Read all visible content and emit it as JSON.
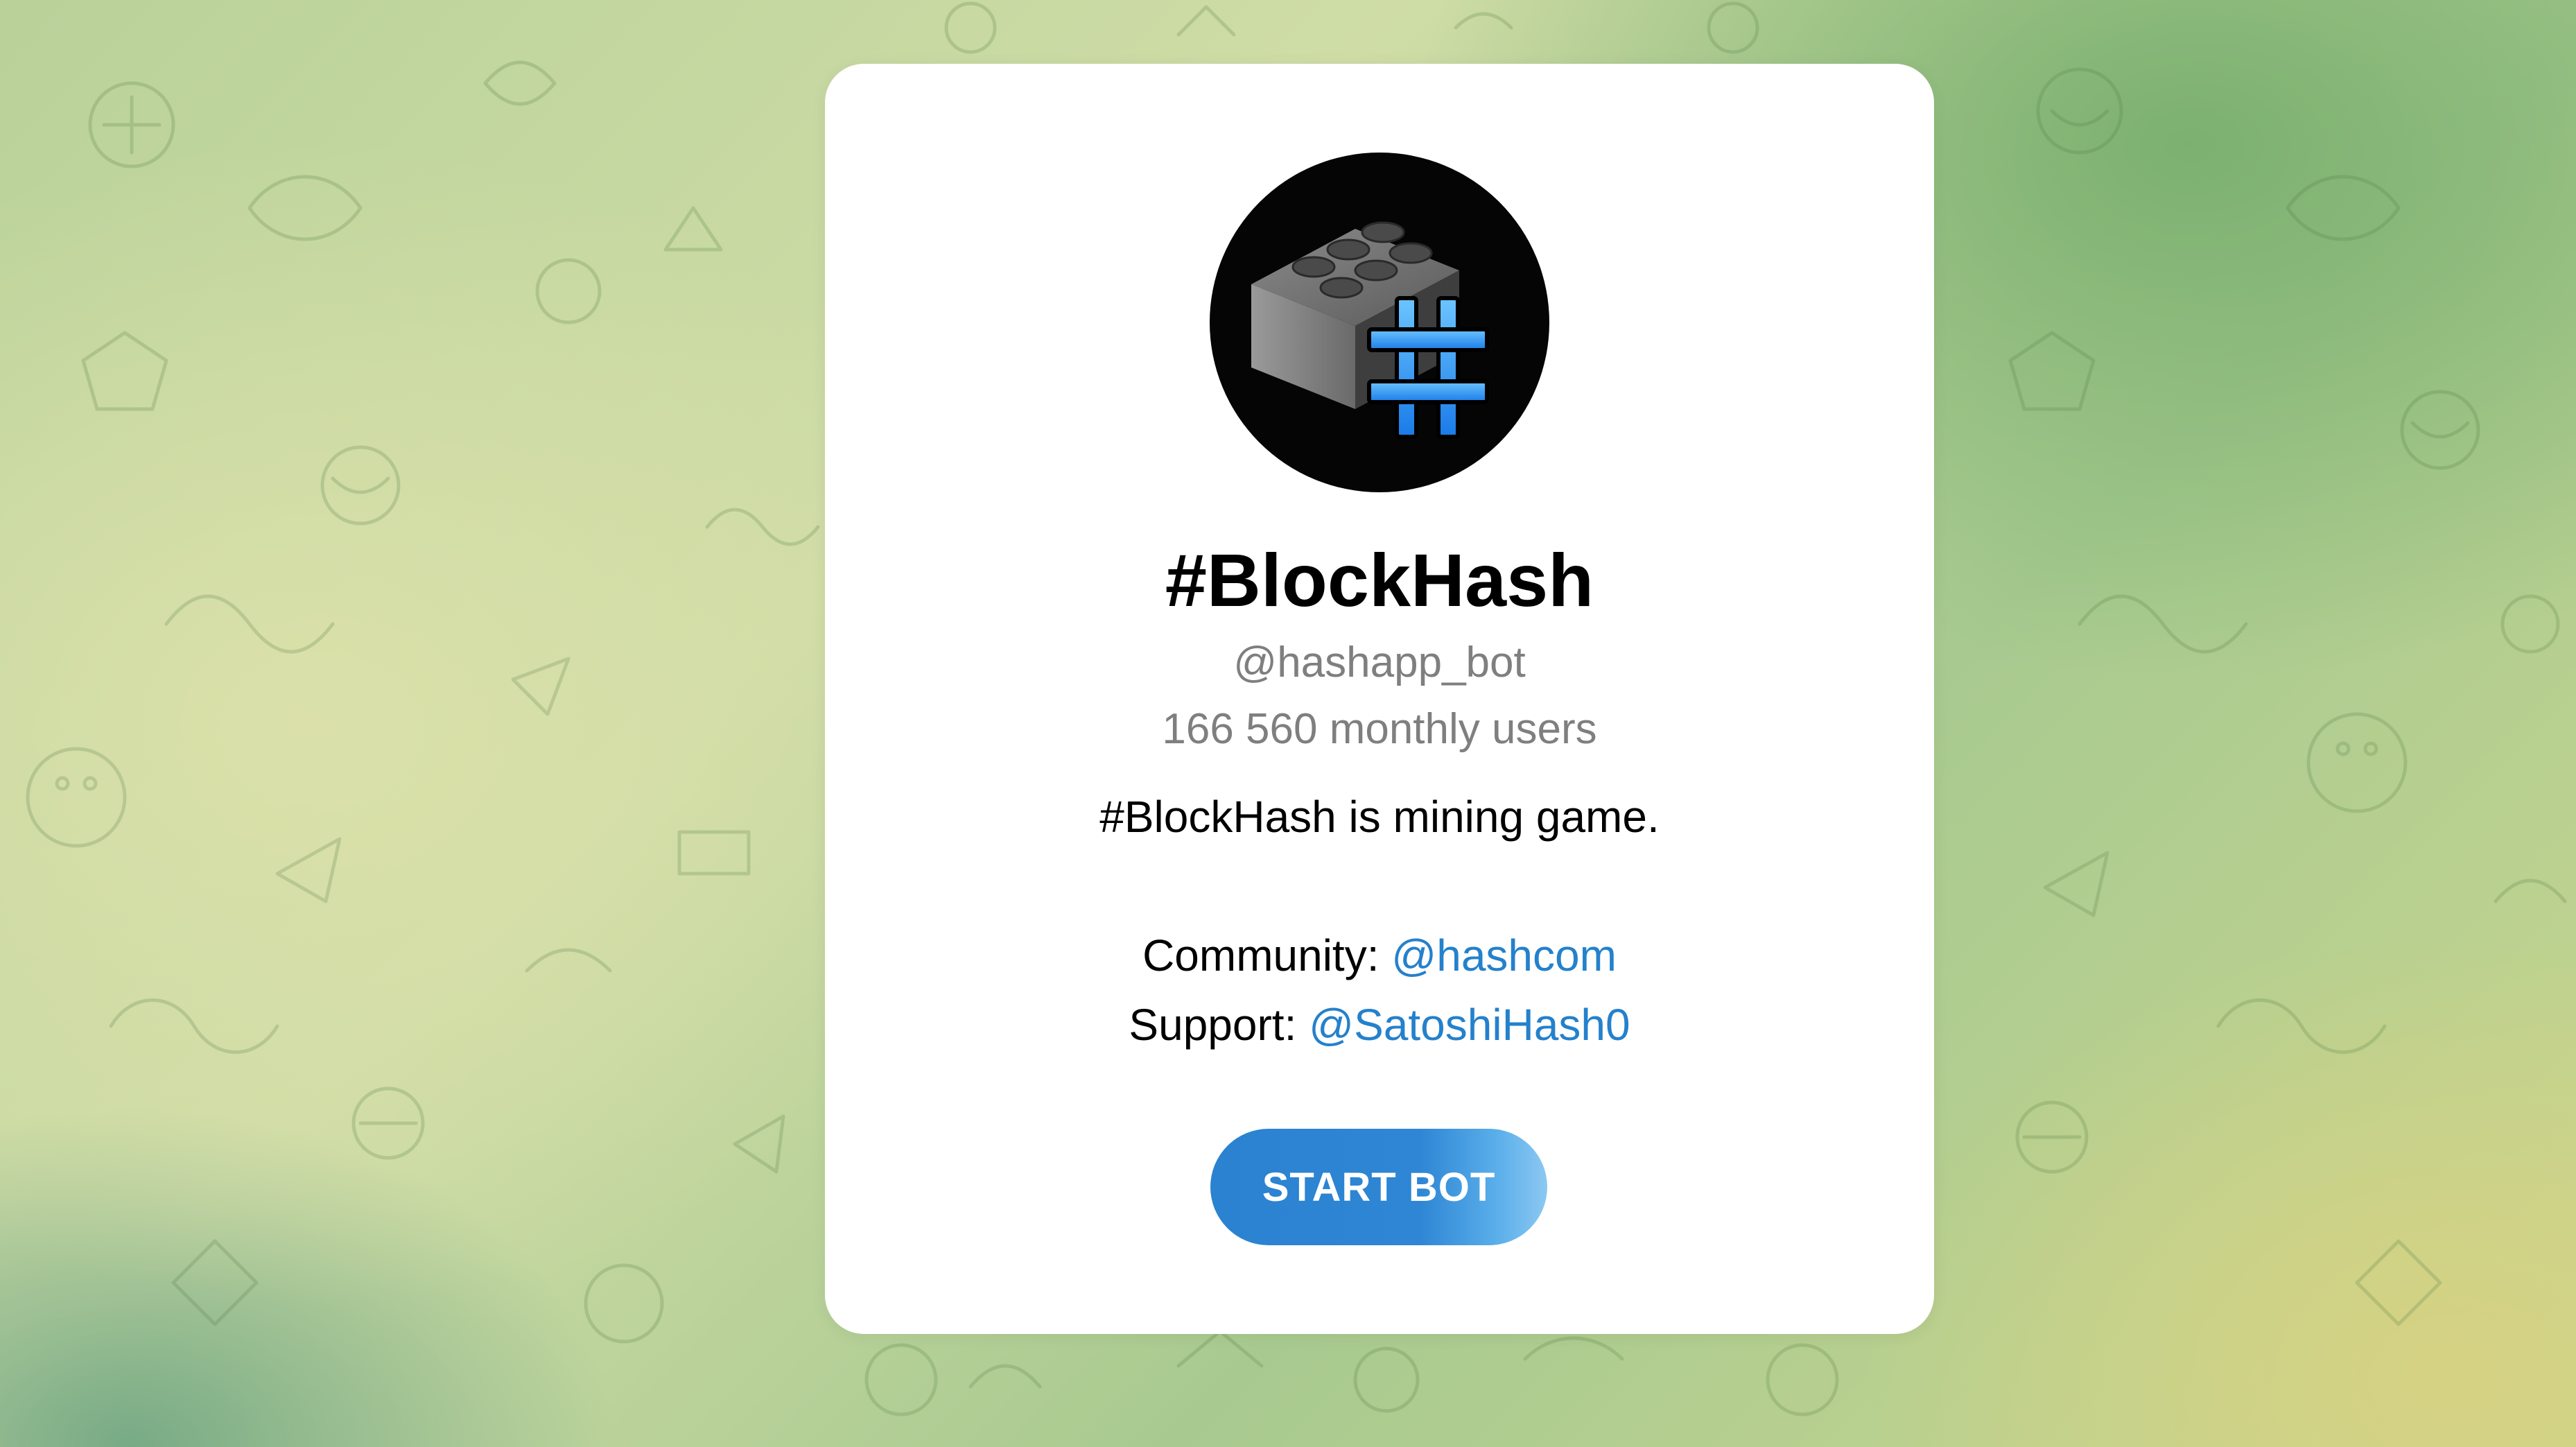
{
  "bot": {
    "name": "#BlockHash",
    "username": "@hashapp_bot",
    "monthly_users": "166 560 monthly users",
    "description": "#BlockHash is mining game.",
    "community_label": "Community: ",
    "community_link": "@hashcom",
    "support_label": "Support: ",
    "support_link": "@SatoshiHash0",
    "avatar_icon": "lego-brick-hash-icon"
  },
  "actions": {
    "start_label": "START BOT"
  },
  "colors": {
    "accent": "#2481cc",
    "button": "#2a82d0",
    "secondary_text": "#7f7f7f",
    "card": "#ffffff"
  }
}
